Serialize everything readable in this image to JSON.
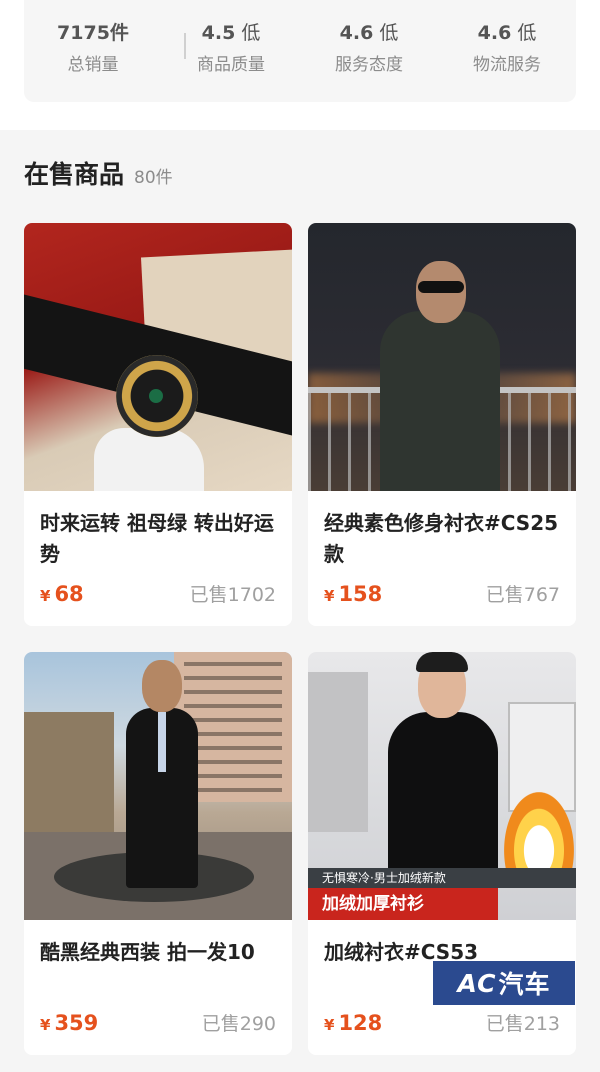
{
  "stats": [
    {
      "value": "7175件",
      "level": "",
      "label": "总销量"
    },
    {
      "value": "4.5",
      "level": "低",
      "label": "商品质量"
    },
    {
      "value": "4.6",
      "level": "低",
      "label": "服务态度"
    },
    {
      "value": "4.6",
      "level": "低",
      "label": "物流服务"
    }
  ],
  "section": {
    "title": "在售商品",
    "count": "80件"
  },
  "products": [
    {
      "name": "时来运转 祖母绿 转出好运势",
      "currency": "¥",
      "price": "68",
      "sold": "已售1702"
    },
    {
      "name": "经典素色修身衬衣#CS25款",
      "currency": "¥",
      "price": "158",
      "sold": "已售767"
    },
    {
      "name": "酷黑经典西装 拍一发10",
      "currency": "¥",
      "price": "359",
      "sold": "已售290"
    },
    {
      "name": "加绒衬衣#CS53",
      "currency": "¥",
      "price": "128",
      "sold": "已售213",
      "banner_top": "无惧寒冷·男士加绒新款",
      "banner_main": "加绒加厚衬衫"
    }
  ],
  "watermark": {
    "logo": "AC",
    "text": "汽车"
  }
}
